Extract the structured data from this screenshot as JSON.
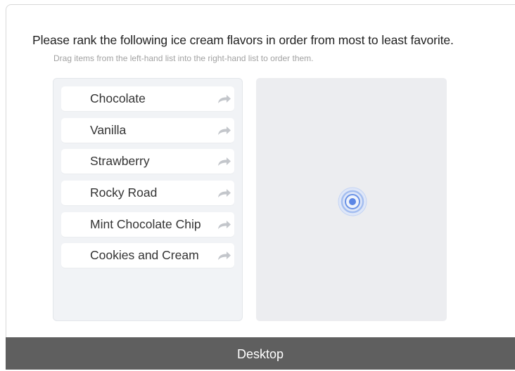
{
  "question": {
    "title": "Please rank the following ice cream flavors in order from most to least favorite.",
    "instructions": "Drag items from the left-hand list into the right-hand list to order them."
  },
  "options": [
    {
      "label": "Chocolate",
      "icon": "curved-arrow-right-icon"
    },
    {
      "label": "Vanilla",
      "icon": "curved-arrow-right-icon"
    },
    {
      "label": "Strawberry",
      "icon": "curved-arrow-right-icon"
    },
    {
      "label": "Rocky Road",
      "icon": "curved-arrow-right-icon"
    },
    {
      "label": "Mint Chocolate Chip",
      "icon": "curved-arrow-right-icon"
    },
    {
      "label": "Cookies and Cream",
      "icon": "curved-arrow-right-icon"
    }
  ],
  "ranked_list": {
    "items": [],
    "indicator_icon": "touch-indicator-icon"
  },
  "footer": {
    "device_label": "Desktop"
  },
  "colors": {
    "left_list_bg": "#f1f3f6",
    "right_list_bg": "#ecedf0",
    "indicator_blue": "#5b86e5",
    "footer_bg": "#5f5f5f"
  }
}
